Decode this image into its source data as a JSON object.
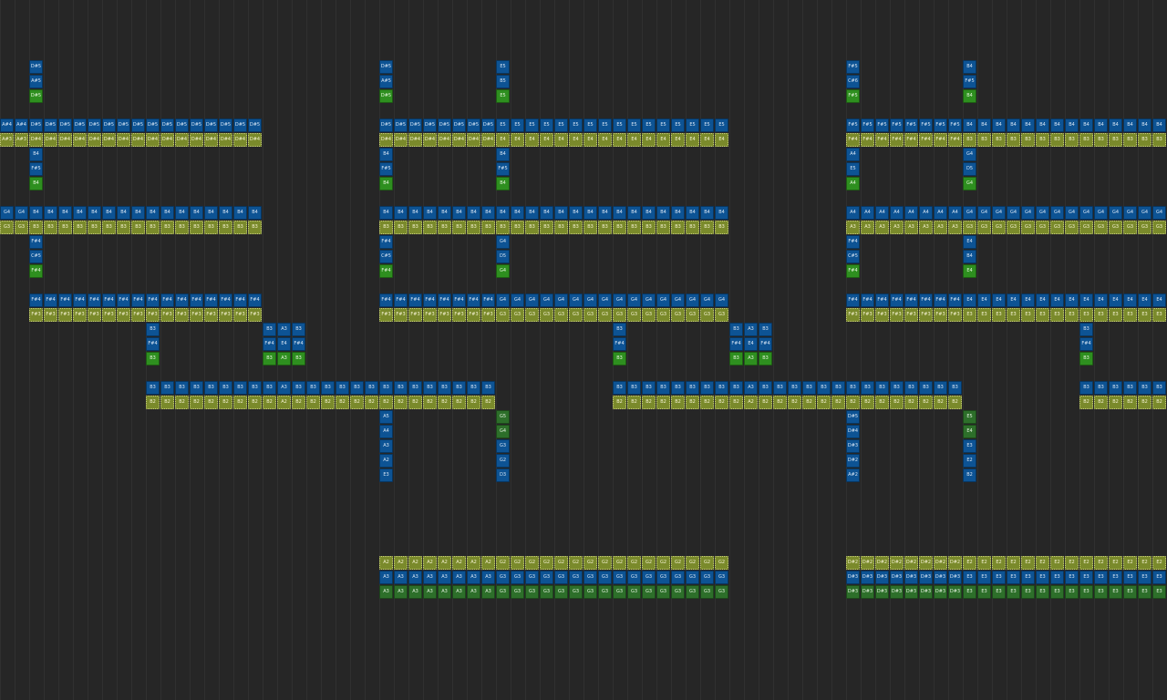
{
  "colors": {
    "background": "#262626",
    "grid_line": "#303030",
    "blue": "#0d5394",
    "green": "#2e8f1f",
    "olive": "#7a8a2b",
    "dgreen": "#2d6f2a"
  },
  "segments": [
    {
      "row": 4,
      "start": 2,
      "n": 1,
      "color": "blue",
      "labels": [
        "D#5"
      ]
    },
    {
      "row": 5,
      "start": 2,
      "n": 1,
      "color": "blue",
      "labels": [
        "A#5"
      ]
    },
    {
      "row": 6,
      "start": 2,
      "n": 1,
      "color": "green",
      "labels": [
        "D#5"
      ]
    },
    {
      "row": 8,
      "start": 0,
      "n": 18,
      "color": "blue",
      "labels": [
        "A#4",
        "A#4",
        "D#5"
      ],
      "fill": "D#5"
    },
    {
      "row": 9,
      "start": 0,
      "n": 18,
      "color": "olive",
      "labels": [
        "A#3",
        "A#3",
        "D#4"
      ],
      "fill": "D#4"
    },
    {
      "row": 10,
      "start": 2,
      "n": 1,
      "color": "blue",
      "labels": [
        "B4"
      ]
    },
    {
      "row": 11,
      "start": 2,
      "n": 1,
      "color": "blue",
      "labels": [
        "F#5"
      ]
    },
    {
      "row": 12,
      "start": 2,
      "n": 1,
      "color": "green",
      "labels": [
        "B4"
      ]
    },
    {
      "row": 14,
      "start": 0,
      "n": 18,
      "color": "blue",
      "labels": [
        "G4",
        "G4",
        "B4"
      ],
      "fill": "B4"
    },
    {
      "row": 15,
      "start": 0,
      "n": 18,
      "color": "olive",
      "labels": [
        "G3",
        "G3",
        "B3"
      ],
      "fill": "B3"
    },
    {
      "row": 16,
      "start": 2,
      "n": 1,
      "color": "blue",
      "labels": [
        "F#4"
      ]
    },
    {
      "row": 17,
      "start": 2,
      "n": 1,
      "color": "blue",
      "labels": [
        "C#5"
      ]
    },
    {
      "row": 18,
      "start": 2,
      "n": 1,
      "color": "green",
      "labels": [
        "F#4"
      ]
    },
    {
      "row": 20,
      "start": 2,
      "n": 16,
      "color": "blue",
      "labels": [],
      "fill": "F#4"
    },
    {
      "row": 21,
      "start": 2,
      "n": 16,
      "color": "olive",
      "labels": [],
      "fill": "F#3"
    },
    {
      "row": 22,
      "start": 10,
      "n": 1,
      "color": "blue",
      "labels": [
        "B3"
      ]
    },
    {
      "row": 23,
      "start": 10,
      "n": 1,
      "color": "blue",
      "labels": [
        "F#4"
      ]
    },
    {
      "row": 24,
      "start": 10,
      "n": 1,
      "color": "green",
      "labels": [
        "B3"
      ]
    },
    {
      "row": 22,
      "start": 18,
      "n": 3,
      "color": "blue",
      "labels": [
        "B3",
        "A3",
        "B3"
      ]
    },
    {
      "row": 23,
      "start": 18,
      "n": 3,
      "color": "blue",
      "labels": [
        "F#4",
        "E4",
        "F#4"
      ]
    },
    {
      "row": 24,
      "start": 18,
      "n": 3,
      "color": "green",
      "labels": [
        "B3",
        "A3",
        "B3"
      ]
    },
    {
      "row": 26,
      "start": 10,
      "n": 24,
      "color": "blue",
      "labels": [
        "B3",
        "B3",
        "B3",
        "B3",
        "B3",
        "B3",
        "B3",
        "B3",
        "B3",
        "A3",
        "B3"
      ],
      "fill": "B3"
    },
    {
      "row": 27,
      "start": 10,
      "n": 24,
      "color": "olive",
      "labels": [
        "B2",
        "B2",
        "B2",
        "B2",
        "B2",
        "B2",
        "B2",
        "B2",
        "B2",
        "A2",
        "B2"
      ],
      "fill": "B2"
    },
    {
      "row": 4,
      "start": 26,
      "n": 1,
      "color": "blue",
      "labels": [
        "D#5"
      ]
    },
    {
      "row": 5,
      "start": 26,
      "n": 1,
      "color": "blue",
      "labels": [
        "A#5"
      ]
    },
    {
      "row": 6,
      "start": 26,
      "n": 1,
      "color": "green",
      "labels": [
        "D#5"
      ]
    },
    {
      "row": 4,
      "start": 34,
      "n": 1,
      "color": "blue",
      "labels": [
        "E5"
      ]
    },
    {
      "row": 5,
      "start": 34,
      "n": 1,
      "color": "blue",
      "labels": [
        "B5"
      ]
    },
    {
      "row": 6,
      "start": 34,
      "n": 1,
      "color": "green",
      "labels": [
        "E5"
      ]
    },
    {
      "row": 8,
      "start": 26,
      "n": 24,
      "color": "blue",
      "labels": [
        "D#5",
        "D#5",
        "D#5",
        "D#5",
        "D#5",
        "D#5",
        "D#5",
        "D#5"
      ],
      "fill": "E5"
    },
    {
      "row": 9,
      "start": 26,
      "n": 24,
      "color": "olive",
      "labels": [
        "D#4",
        "D#4",
        "D#4",
        "D#4",
        "D#4",
        "D#4",
        "D#4",
        "D#4"
      ],
      "fill": "E4"
    },
    {
      "row": 10,
      "start": 26,
      "n": 1,
      "color": "blue",
      "labels": [
        "B4"
      ]
    },
    {
      "row": 11,
      "start": 26,
      "n": 1,
      "color": "blue",
      "labels": [
        "F#5"
      ]
    },
    {
      "row": 12,
      "start": 26,
      "n": 1,
      "color": "green",
      "labels": [
        "B4"
      ]
    },
    {
      "row": 10,
      "start": 34,
      "n": 1,
      "color": "blue",
      "labels": [
        "B4"
      ]
    },
    {
      "row": 11,
      "start": 34,
      "n": 1,
      "color": "blue",
      "labels": [
        "F#5"
      ]
    },
    {
      "row": 12,
      "start": 34,
      "n": 1,
      "color": "green",
      "labels": [
        "B4"
      ]
    },
    {
      "row": 14,
      "start": 26,
      "n": 24,
      "color": "blue",
      "labels": [],
      "fill": "B4"
    },
    {
      "row": 15,
      "start": 26,
      "n": 24,
      "color": "olive",
      "labels": [],
      "fill": "B3"
    },
    {
      "row": 16,
      "start": 26,
      "n": 1,
      "color": "blue",
      "labels": [
        "F#4"
      ]
    },
    {
      "row": 17,
      "start": 26,
      "n": 1,
      "color": "blue",
      "labels": [
        "C#5"
      ]
    },
    {
      "row": 18,
      "start": 26,
      "n": 1,
      "color": "green",
      "labels": [
        "F#4"
      ]
    },
    {
      "row": 16,
      "start": 34,
      "n": 1,
      "color": "blue",
      "labels": [
        "G4"
      ]
    },
    {
      "row": 17,
      "start": 34,
      "n": 1,
      "color": "blue",
      "labels": [
        "D5"
      ]
    },
    {
      "row": 18,
      "start": 34,
      "n": 1,
      "color": "green",
      "labels": [
        "G4"
      ]
    },
    {
      "row": 20,
      "start": 26,
      "n": 24,
      "color": "blue",
      "labels": [
        "F#4",
        "F#4",
        "F#4",
        "F#4",
        "F#4",
        "F#4",
        "F#4",
        "F#4"
      ],
      "fill": "G4"
    },
    {
      "row": 21,
      "start": 26,
      "n": 24,
      "color": "olive",
      "labels": [
        "F#3",
        "F#3",
        "F#3",
        "F#3",
        "F#3",
        "F#3",
        "F#3",
        "F#3"
      ],
      "fill": "G3"
    },
    {
      "row": 28,
      "start": 26,
      "n": 1,
      "color": "blue",
      "labels": [
        "A5"
      ]
    },
    {
      "row": 29,
      "start": 26,
      "n": 1,
      "color": "blue",
      "labels": [
        "A4"
      ]
    },
    {
      "row": 30,
      "start": 26,
      "n": 1,
      "color": "blue",
      "labels": [
        "A3"
      ]
    },
    {
      "row": 31,
      "start": 26,
      "n": 1,
      "color": "blue",
      "labels": [
        "A2"
      ]
    },
    {
      "row": 32,
      "start": 26,
      "n": 1,
      "color": "blue",
      "labels": [
        "E3"
      ]
    },
    {
      "row": 28,
      "start": 34,
      "n": 1,
      "color": "dgreen",
      "labels": [
        "G5"
      ]
    },
    {
      "row": 29,
      "start": 34,
      "n": 1,
      "color": "dgreen",
      "labels": [
        "G4"
      ]
    },
    {
      "row": 30,
      "start": 34,
      "n": 1,
      "color": "blue",
      "labels": [
        "G3"
      ]
    },
    {
      "row": 31,
      "start": 34,
      "n": 1,
      "color": "blue",
      "labels": [
        "G2"
      ]
    },
    {
      "row": 32,
      "start": 34,
      "n": 1,
      "color": "blue",
      "labels": [
        "D3"
      ]
    },
    {
      "row": 38,
      "start": 26,
      "n": 24,
      "color": "olive",
      "labels": [
        "A2",
        "A2",
        "A2",
        "A2",
        "A2",
        "A2",
        "A2",
        "A2"
      ],
      "fill": "G2"
    },
    {
      "row": 39,
      "start": 26,
      "n": 24,
      "color": "blue",
      "labels": [
        "A3",
        "A3",
        "A3",
        "A3",
        "A3",
        "A3",
        "A3",
        "A3"
      ],
      "fill": "G3"
    },
    {
      "row": 40,
      "start": 26,
      "n": 24,
      "color": "dgreen",
      "labels": [
        "A3",
        "A3",
        "A3",
        "A3",
        "A3",
        "A3",
        "A3",
        "A3"
      ],
      "fill": "G3"
    },
    {
      "row": 22,
      "start": 42,
      "n": 1,
      "color": "blue",
      "labels": [
        "B3"
      ]
    },
    {
      "row": 23,
      "start": 42,
      "n": 1,
      "color": "blue",
      "labels": [
        "F#4"
      ]
    },
    {
      "row": 24,
      "start": 42,
      "n": 1,
      "color": "green",
      "labels": [
        "B3"
      ]
    },
    {
      "row": 22,
      "start": 50,
      "n": 3,
      "color": "blue",
      "labels": [
        "B3",
        "A3",
        "B3"
      ]
    },
    {
      "row": 23,
      "start": 50,
      "n": 3,
      "color": "blue",
      "labels": [
        "F#4",
        "E4",
        "F#4"
      ]
    },
    {
      "row": 24,
      "start": 50,
      "n": 3,
      "color": "green",
      "labels": [
        "B3",
        "A3",
        "B3"
      ]
    },
    {
      "row": 26,
      "start": 42,
      "n": 24,
      "color": "blue",
      "labels": [
        "B3",
        "B3",
        "B3",
        "B3",
        "B3",
        "B3",
        "B3",
        "B3",
        "B3",
        "A3",
        "B3"
      ],
      "fill": "B3"
    },
    {
      "row": 27,
      "start": 42,
      "n": 24,
      "color": "olive",
      "labels": [
        "B2",
        "B2",
        "B2",
        "B2",
        "B2",
        "B2",
        "B2",
        "B2",
        "B2",
        "A2",
        "B2"
      ],
      "fill": "B2"
    },
    {
      "row": 4,
      "start": 58,
      "n": 1,
      "color": "blue",
      "labels": [
        "F#5"
      ]
    },
    {
      "row": 5,
      "start": 58,
      "n": 1,
      "color": "blue",
      "labels": [
        "C#6"
      ]
    },
    {
      "row": 6,
      "start": 58,
      "n": 1,
      "color": "green",
      "labels": [
        "F#5"
      ]
    },
    {
      "row": 4,
      "start": 66,
      "n": 1,
      "color": "blue",
      "labels": [
        "B4"
      ]
    },
    {
      "row": 5,
      "start": 66,
      "n": 1,
      "color": "blue",
      "labels": [
        "F#5"
      ]
    },
    {
      "row": 6,
      "start": 66,
      "n": 1,
      "color": "green",
      "labels": [
        "B4"
      ]
    },
    {
      "row": 8,
      "start": 58,
      "n": 22,
      "color": "blue",
      "labels": [
        "F#5",
        "F#5",
        "F#5",
        "F#5",
        "F#5",
        "F#5",
        "F#5",
        "F#5"
      ],
      "fill": "B4"
    },
    {
      "row": 9,
      "start": 58,
      "n": 22,
      "color": "olive",
      "labels": [
        "F#4",
        "F#4",
        "F#4",
        "F#4",
        "F#4",
        "F#4",
        "F#4",
        "F#4"
      ],
      "fill": "B3"
    },
    {
      "row": 10,
      "start": 58,
      "n": 1,
      "color": "blue",
      "labels": [
        "A4"
      ]
    },
    {
      "row": 11,
      "start": 58,
      "n": 1,
      "color": "blue",
      "labels": [
        "E5"
      ]
    },
    {
      "row": 12,
      "start": 58,
      "n": 1,
      "color": "green",
      "labels": [
        "A4"
      ]
    },
    {
      "row": 10,
      "start": 66,
      "n": 1,
      "color": "blue",
      "labels": [
        "G4"
      ]
    },
    {
      "row": 11,
      "start": 66,
      "n": 1,
      "color": "blue",
      "labels": [
        "D5"
      ]
    },
    {
      "row": 12,
      "start": 66,
      "n": 1,
      "color": "green",
      "labels": [
        "G4"
      ]
    },
    {
      "row": 14,
      "start": 58,
      "n": 22,
      "color": "blue",
      "labels": [
        "A4",
        "A4",
        "A4",
        "A4",
        "A4",
        "A4",
        "A4",
        "A4"
      ],
      "fill": "G4"
    },
    {
      "row": 15,
      "start": 58,
      "n": 22,
      "color": "olive",
      "labels": [
        "A3",
        "A3",
        "A3",
        "A3",
        "A3",
        "A3",
        "A3",
        "A3"
      ],
      "fill": "G3"
    },
    {
      "row": 16,
      "start": 58,
      "n": 1,
      "color": "blue",
      "labels": [
        "F#4"
      ]
    },
    {
      "row": 17,
      "start": 58,
      "n": 1,
      "color": "blue",
      "labels": [
        "C#5"
      ]
    },
    {
      "row": 18,
      "start": 58,
      "n": 1,
      "color": "green",
      "labels": [
        "F#4"
      ]
    },
    {
      "row": 16,
      "start": 66,
      "n": 1,
      "color": "blue",
      "labels": [
        "E4"
      ]
    },
    {
      "row": 17,
      "start": 66,
      "n": 1,
      "color": "blue",
      "labels": [
        "B4"
      ]
    },
    {
      "row": 18,
      "start": 66,
      "n": 1,
      "color": "green",
      "labels": [
        "E4"
      ]
    },
    {
      "row": 20,
      "start": 58,
      "n": 22,
      "color": "blue",
      "labels": [
        "F#4",
        "F#4",
        "F#4",
        "F#4",
        "F#4",
        "F#4",
        "F#4",
        "F#4"
      ],
      "fill": "E4"
    },
    {
      "row": 21,
      "start": 58,
      "n": 22,
      "color": "olive",
      "labels": [
        "F#3",
        "F#3",
        "F#3",
        "F#3",
        "F#3",
        "F#3",
        "F#3",
        "F#3"
      ],
      "fill": "E3"
    },
    {
      "row": 28,
      "start": 58,
      "n": 1,
      "color": "blue",
      "labels": [
        "D#5"
      ]
    },
    {
      "row": 29,
      "start": 58,
      "n": 1,
      "color": "blue",
      "labels": [
        "D#4"
      ]
    },
    {
      "row": 30,
      "start": 58,
      "n": 1,
      "color": "blue",
      "labels": [
        "D#3"
      ]
    },
    {
      "row": 31,
      "start": 58,
      "n": 1,
      "color": "blue",
      "labels": [
        "D#2"
      ]
    },
    {
      "row": 32,
      "start": 58,
      "n": 1,
      "color": "blue",
      "labels": [
        "A#2"
      ]
    },
    {
      "row": 28,
      "start": 66,
      "n": 1,
      "color": "dgreen",
      "labels": [
        "E5"
      ]
    },
    {
      "row": 29,
      "start": 66,
      "n": 1,
      "color": "dgreen",
      "labels": [
        "E4"
      ]
    },
    {
      "row": 30,
      "start": 66,
      "n": 1,
      "color": "blue",
      "labels": [
        "E3"
      ]
    },
    {
      "row": 31,
      "start": 66,
      "n": 1,
      "color": "blue",
      "labels": [
        "E2"
      ]
    },
    {
      "row": 32,
      "start": 66,
      "n": 1,
      "color": "blue",
      "labels": [
        "B2"
      ]
    },
    {
      "row": 38,
      "start": 58,
      "n": 22,
      "color": "olive",
      "labels": [
        "D#2",
        "D#2",
        "D#2",
        "D#2",
        "D#2",
        "D#2",
        "D#2",
        "D#2"
      ],
      "fill": "E2"
    },
    {
      "row": 39,
      "start": 58,
      "n": 22,
      "color": "blue",
      "labels": [
        "D#3",
        "D#3",
        "D#3",
        "D#3",
        "D#3",
        "D#3",
        "D#3",
        "D#3"
      ],
      "fill": "E3"
    },
    {
      "row": 40,
      "start": 58,
      "n": 22,
      "color": "dgreen",
      "labels": [
        "D#3",
        "D#3",
        "D#3",
        "D#3",
        "D#3",
        "D#3",
        "D#3",
        "D#3"
      ],
      "fill": "E3"
    },
    {
      "row": 22,
      "start": 74,
      "n": 1,
      "color": "blue",
      "labels": [
        "B3"
      ]
    },
    {
      "row": 23,
      "start": 74,
      "n": 1,
      "color": "blue",
      "labels": [
        "F#4"
      ]
    },
    {
      "row": 24,
      "start": 74,
      "n": 1,
      "color": "green",
      "labels": [
        "B3"
      ]
    },
    {
      "row": 26,
      "start": 74,
      "n": 6,
      "color": "blue",
      "labels": [],
      "fill": "B3"
    },
    {
      "row": 27,
      "start": 74,
      "n": 6,
      "color": "olive",
      "labels": [],
      "fill": "B2"
    }
  ]
}
